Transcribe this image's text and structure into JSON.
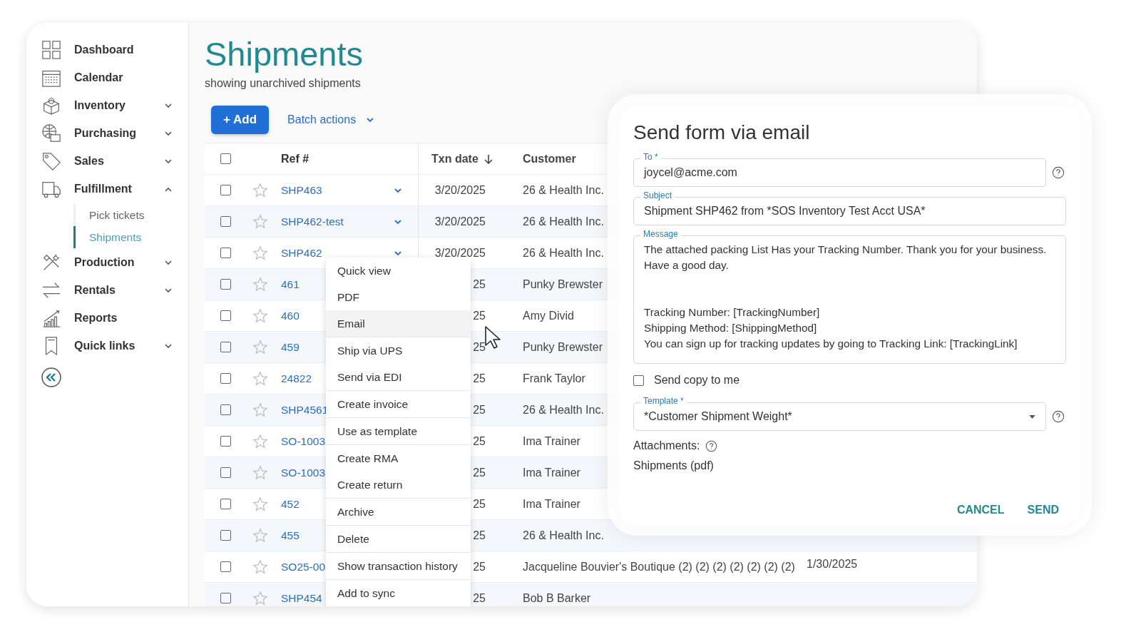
{
  "sidebar": {
    "items": [
      {
        "label": "Dashboard"
      },
      {
        "label": "Calendar"
      },
      {
        "label": "Inventory",
        "expanded": false
      },
      {
        "label": "Purchasing",
        "expanded": false
      },
      {
        "label": "Sales",
        "expanded": false
      },
      {
        "label": "Fulfillment",
        "expanded": true,
        "children": [
          {
            "label": "Pick tickets",
            "selected": false
          },
          {
            "label": "Shipments",
            "selected": true
          }
        ]
      },
      {
        "label": "Production",
        "expanded": false
      },
      {
        "label": "Rentals",
        "expanded": false
      },
      {
        "label": "Reports"
      },
      {
        "label": "Quick links",
        "expanded": false
      }
    ]
  },
  "page": {
    "title": "Shipments",
    "subtitle": "showing unarchived shipments"
  },
  "toolbar": {
    "add_button": "+ Add",
    "batch_actions": "Batch actions"
  },
  "table": {
    "all_checked": false,
    "columns": [
      "Ref #",
      "Txn date",
      "Customer"
    ],
    "rows": [
      {
        "checked": false,
        "starred": false,
        "ref": "SHP463",
        "dropdown": true,
        "txn_date": "3/20/2025",
        "customer": "26 & Health Inc."
      },
      {
        "checked": false,
        "starred": false,
        "ref": "SHP462-test",
        "dropdown": true,
        "txn_date": "3/20/2025",
        "customer": "26 & Health Inc."
      },
      {
        "checked": false,
        "starred": false,
        "ref": "SHP462",
        "dropdown": true,
        "txn_date": "3/20/2025",
        "customer": "26 & Health Inc."
      },
      {
        "checked": false,
        "starred": false,
        "ref": "461",
        "dropdown": false,
        "txn_date": "25",
        "customer": "Punky Brewster"
      },
      {
        "checked": false,
        "starred": false,
        "ref": "460",
        "dropdown": false,
        "txn_date": "25",
        "customer": "Amy Divid"
      },
      {
        "checked": false,
        "starred": false,
        "ref": "459",
        "dropdown": false,
        "txn_date": "25",
        "customer": "Punky Brewster"
      },
      {
        "checked": false,
        "starred": false,
        "ref": "24822",
        "dropdown": false,
        "txn_date": "25",
        "customer": "Frank Taylor"
      },
      {
        "checked": false,
        "starred": false,
        "ref": "SHP4561",
        "dropdown": false,
        "txn_date": "25",
        "customer": "26 & Health Inc."
      },
      {
        "checked": false,
        "starred": false,
        "ref": "SO-1003",
        "dropdown": false,
        "txn_date": "25",
        "customer": "Ima Trainer"
      },
      {
        "checked": false,
        "starred": false,
        "ref": "SO-1003",
        "dropdown": false,
        "txn_date": "25",
        "customer": "Ima Trainer"
      },
      {
        "checked": false,
        "starred": false,
        "ref": "452",
        "dropdown": false,
        "txn_date": "25",
        "customer": "Ima Trainer"
      },
      {
        "checked": false,
        "starred": false,
        "ref": "455",
        "dropdown": false,
        "txn_date": "25",
        "customer": "26 & Health Inc."
      },
      {
        "checked": false,
        "starred": false,
        "ref": "SO25-00",
        "dropdown": false,
        "txn_date": "25",
        "customer": "Jacqueline Bouvier's Boutique (2) (2) (2) (2) (2) (2) (2)",
        "column_4": "1/30/2025"
      },
      {
        "checked": false,
        "starred": false,
        "ref": "SHP454",
        "dropdown": false,
        "txn_date": "25",
        "customer": "Bob B Barker"
      }
    ]
  },
  "context_menu": {
    "groups": [
      [
        {
          "label": "Quick view",
          "highlighted": false
        },
        {
          "label": "PDF",
          "highlighted": false
        },
        {
          "label": "Email",
          "highlighted": true
        }
      ],
      [
        {
          "label": "Ship via UPS",
          "highlighted": false
        },
        {
          "label": "Send via EDI",
          "highlighted": false
        }
      ],
      [
        {
          "label": "Create invoice",
          "highlighted": false
        }
      ],
      [
        {
          "label": "Use as template",
          "highlighted": false
        }
      ],
      [
        {
          "label": "Create RMA",
          "highlighted": false
        },
        {
          "label": "Create return",
          "highlighted": false
        }
      ],
      [
        {
          "label": "Archive",
          "highlighted": false
        }
      ],
      [
        {
          "label": "Delete",
          "highlighted": false
        }
      ],
      [
        {
          "label": "Show transaction history",
          "highlighted": false
        }
      ],
      [
        {
          "label": "Add to sync",
          "highlighted": false
        }
      ]
    ]
  },
  "dialog": {
    "title": "Send form via email",
    "to": {
      "label": "To *",
      "value": "joycel@acme.com"
    },
    "subject": {
      "label": "Subject",
      "value": "Shipment SHP462 from *SOS Inventory Test Acct USA*"
    },
    "message": {
      "label": "Message",
      "paragraphs": [
        [
          "The attached packing List Has your Tracking Number. Thank you for your business.",
          "Have a good day."
        ],
        [
          "Tracking Number:  [TrackingNumber]",
          "Shipping Method: [ShippingMethod]",
          "You can sign up for tracking updates by going to Tracking Link: [TrackingLink]"
        ]
      ]
    },
    "send_copy": {
      "label": "Send copy to me",
      "checked": false
    },
    "template": {
      "label": "Template *",
      "value": "*Customer Shipment Weight*"
    },
    "attachments_label": "Attachments:",
    "attachment": "Shipments (pdf)",
    "buttons": [
      "CANCEL",
      "SEND"
    ]
  }
}
